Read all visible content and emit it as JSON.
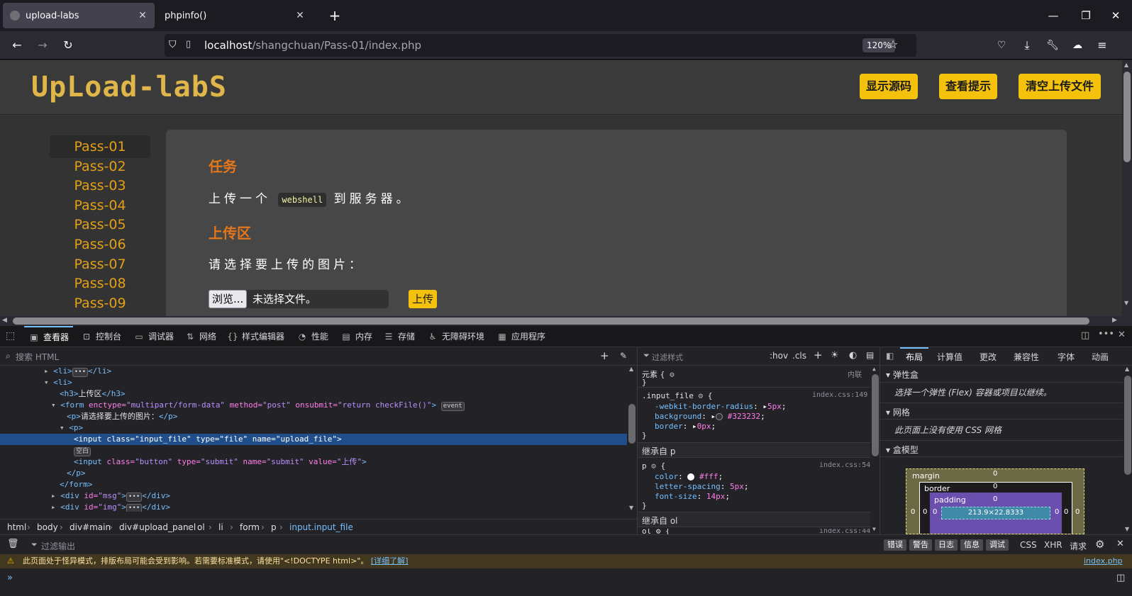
{
  "browser": {
    "tabs": [
      {
        "label": "upload-labs",
        "active": true
      },
      {
        "label": "phpinfo()",
        "active": false
      }
    ],
    "url_host": "localhost",
    "url_path": "/shangchuan/Pass-01/index.php",
    "zoom": "120%"
  },
  "page": {
    "logo_text": "UpLoad-labS",
    "header_buttons": [
      "显示源码",
      "查看提示",
      "清空上传文件"
    ],
    "pass_items": [
      "Pass-01",
      "Pass-02",
      "Pass-03",
      "Pass-04",
      "Pass-05",
      "Pass-06",
      "Pass-07",
      "Pass-08",
      "Pass-09"
    ],
    "task_heading": "任务",
    "task_pre": "上传一个",
    "task_code": "webshell",
    "task_post": "到服务器。",
    "upload_heading": "上传区",
    "choose_prompt": "请选择要上传的图片：",
    "browse_label": "浏览...",
    "no_file_label": "未选择文件。",
    "upload_button": "上传"
  },
  "devtools": {
    "tabs": [
      "查看器",
      "控制台",
      "调试器",
      "网络",
      "样式编辑器",
      "性能",
      "内存",
      "存储",
      "无障碍环境",
      "应用程序"
    ],
    "search_placeholder": "搜索 HTML",
    "markup": {
      "l1a": "<li>",
      "l1b": "</li>",
      "l2": "<li>",
      "l3a": "<h3>",
      "l3b": "上传区",
      "l3c": "</h3>",
      "l4_tag": "<form",
      "l4_a1": " enctype=",
      "l4_v1": "\"multipart/form-data\"",
      "l4_a2": " method=",
      "l4_v2": "\"post\"",
      "l4_a3": " onsubmit=",
      "l4_v3": "\"return checkFile()\"",
      "l4_end": ">",
      "l4_badge": "event",
      "l5a": "<p>",
      "l5b": "请选择要上传的图片：",
      "l5c": "</p>",
      "l6": "<p>",
      "l7_tag": "<input",
      "l7_a1": " class=",
      "l7_v1": "\"input_file\"",
      "l7_a2": " type=",
      "l7_v2": "\"file\"",
      "l7_a3": " name=",
      "l7_v3": "\"upload_file\"",
      "l7_end": ">",
      "l8_badge": "空白",
      "l9_tag": "<input",
      "l9_a1": " class=",
      "l9_v1": "\"button\"",
      "l9_a2": " type=",
      "l9_v2": "\"submit\"",
      "l9_a3": " name=",
      "l9_v3": "\"submit\"",
      "l9_a4": " value=",
      "l9_v4": "\"上传\"",
      "l9_end": ">",
      "l10": "</p>",
      "l11": "</form>",
      "l12_tag": "<div",
      "l12_a": " id=",
      "l12_v": "\"msg\"",
      "l12_end": ">",
      "l12_close": "</div>",
      "l13_tag": "<div",
      "l13_a": " id=",
      "l13_v": "\"img\"",
      "l13_end": ">",
      "l13_close": "</div>"
    },
    "breadcrumb": [
      "html",
      "body",
      "div#main",
      "div#upload_panel",
      "ol",
      "li",
      "form",
      "p",
      "input.input_file"
    ],
    "rules": {
      "filter_placeholder": "过滤样式",
      "hov": ":hov",
      "cls": ".cls",
      "element_label": "元素 {",
      "element_close": "}",
      "inline_label": "内联",
      "rule1_selector": ".input_file",
      "rule1_source": "index.css:149",
      "rule1_props": [
        {
          "name": "-webkit-border-radius",
          "value": "5px"
        },
        {
          "name": "background",
          "value": "#323232"
        },
        {
          "name": "border",
          "value": "0px"
        }
      ],
      "inherit_p": "继承自 p",
      "rule2_selector": "p",
      "rule2_source": "index.css:54",
      "rule2_props": [
        {
          "name": "color",
          "value": "#fff"
        },
        {
          "name": "letter-spacing",
          "value": "5px"
        },
        {
          "name": "font-size",
          "value": "14px"
        }
      ],
      "inherit_ol": "继承自 ol",
      "rule3_selector": "ol",
      "rule3_source": "index.css:44"
    },
    "layout": {
      "tabs": [
        "布局",
        "计算值",
        "更改",
        "兼容性",
        "字体",
        "动画"
      ],
      "flex_heading": "弹性盒",
      "flex_text": "选择一个弹性 (Flex) 容器或项目以继续。",
      "grid_heading": "网格",
      "grid_text": "此页面上没有使用 CSS 网格",
      "box_heading": "盒模型",
      "box_labels": {
        "margin": "margin",
        "border": "border",
        "padding": "padding",
        "content": "213.9×22.8333",
        "zero": "0"
      }
    },
    "console": {
      "filter_placeholder": "过滤输出",
      "chips": [
        "错误",
        "警告",
        "日志",
        "信息",
        "调试"
      ],
      "right_labels": [
        "CSS",
        "XHR",
        "请求"
      ],
      "warning_text": "此页面处于怪异模式，排版布局可能会受到影响。若需要标准模式，请使用\"<!DOCTYPE html>\"。",
      "warning_link": "[详细了解]",
      "warning_source": "index.php"
    }
  },
  "colors": {
    "accent_yellow": "#f4c20d",
    "pass_orange": "#e3a017",
    "heading_orange": "#e4761b",
    "selection_blue": "#204e8a"
  }
}
